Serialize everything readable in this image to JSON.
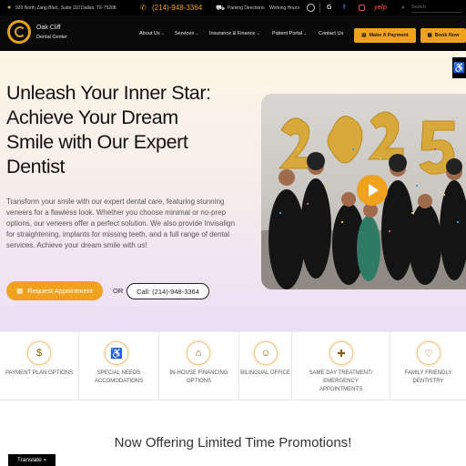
{
  "topbar": {
    "address": "920 North Zang Blvd., Suite 110 Dallas, TX-75208",
    "phone": "(214)-948-3364",
    "links": {
      "parking": "Parking Directions",
      "hours": "Working Hours"
    },
    "social": {
      "google": "G",
      "facebook": "f",
      "yelp": "yelp"
    },
    "search_placeholder": "Search"
  },
  "nav": {
    "logo_line1": "Oak Cliff",
    "logo_line2": "Dental Center",
    "menu": [
      {
        "label": "About Us",
        "caret": "⌄"
      },
      {
        "label": "Services",
        "caret": "⌄"
      },
      {
        "label": "Insurance & Finance",
        "caret": "⌄"
      },
      {
        "label": "Patient Portal",
        "caret": "⌄"
      },
      {
        "label": "Contact Us"
      }
    ],
    "make_payment": "Make A Payment",
    "book_now": "Book Now"
  },
  "hero": {
    "headline": "Unleash Your Inner Star: Achieve Your Dream Smile with Our Expert Dentist",
    "intro": "Transform your smile with our expert dental care, featuring stunning veneers for a flawless look. Whether you choose minimal or no-prep options, our veneers offer a perfect solution. We also provide Invisalign for straightening, implants for missing teeth, and a full range of dental services. Achieve your dream smile with us!",
    "request_btn": "Request Appointment",
    "or_text": "OR",
    "call_btn": "Call: (214)-948-3364"
  },
  "features": [
    {
      "icon": "payment-plan-icon",
      "glyph": "$",
      "label": "Payment Plan Options"
    },
    {
      "icon": "special-needs-icon",
      "glyph": "♿",
      "label": "Special Needs Accomodations"
    },
    {
      "icon": "in-house-financing-icon",
      "glyph": "⌂",
      "label": "In-House Financing Options"
    },
    {
      "icon": "bilingual-icon",
      "glyph": "☺",
      "label": "Bilingual Office"
    },
    {
      "icon": "emergency-icon",
      "glyph": "✚",
      "label": "Same Day Treatment/ Emergency Appointments"
    },
    {
      "icon": "tooth-icon",
      "glyph": "♡",
      "label": "Family Friendly Dentistry"
    }
  ],
  "promo_heading": "Now Offering Limited Time Promotions!",
  "translate_btn": "Translate »",
  "colors": {
    "accent": "#f0a21e",
    "topbar": "#000000",
    "nav": "#0a0a0a"
  }
}
